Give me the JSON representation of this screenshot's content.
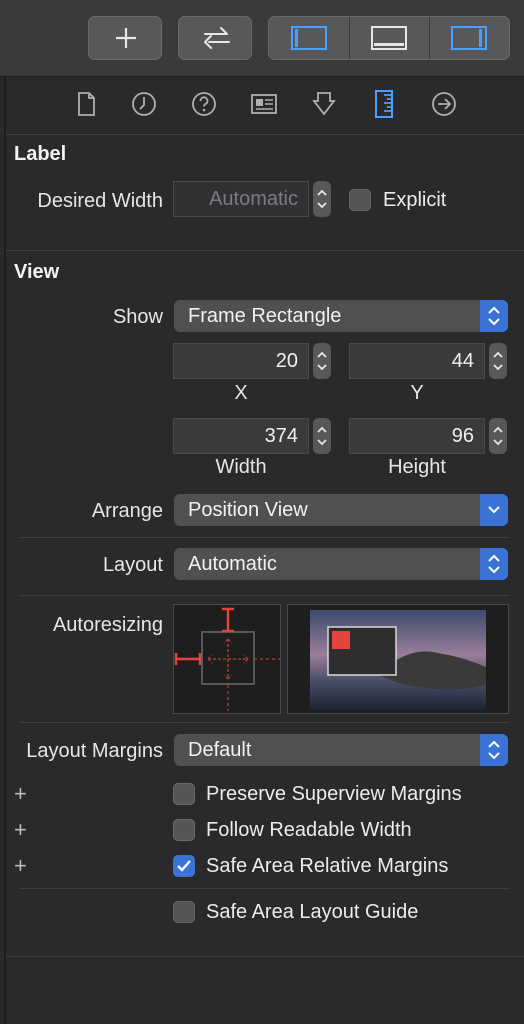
{
  "toolbar": {
    "add_icon": "plus-icon",
    "swap_icon": "arrows-left-right-icon",
    "panels": [
      "left-panel-icon",
      "bottom-panel-icon",
      "right-panel-icon"
    ],
    "active_color": "#4aa0ff"
  },
  "inspector_tabs": [
    "file-icon",
    "history-icon",
    "help-icon",
    "identity-icon",
    "attributes-icon",
    "size-ruler-icon",
    "connections-icon"
  ],
  "label_section": {
    "title": "Label",
    "desired_width_label": "Desired Width",
    "desired_width_value": "Automatic",
    "explicit_label": "Explicit",
    "explicit_checked": false
  },
  "view_section": {
    "title": "View",
    "show_label": "Show",
    "show_value": "Frame Rectangle",
    "x_value": "20",
    "y_value": "44",
    "x_label": "X",
    "y_label": "Y",
    "width_value": "374",
    "height_value": "96",
    "width_label": "Width",
    "height_label": "Height",
    "arrange_label": "Arrange",
    "arrange_value": "Position View",
    "layout_label": "Layout",
    "layout_value": "Automatic",
    "autoresizing_label": "Autoresizing",
    "layout_margins_label": "Layout Margins",
    "layout_margins_value": "Default",
    "checkboxes": [
      {
        "label": "Preserve Superview Margins",
        "checked": false,
        "has_plus": true
      },
      {
        "label": "Follow Readable Width",
        "checked": false,
        "has_plus": true
      },
      {
        "label": "Safe Area Relative Margins",
        "checked": true,
        "has_plus": true
      },
      {
        "label": "Safe Area Layout Guide",
        "checked": false,
        "has_plus": false
      }
    ],
    "plus_symbol": "+"
  }
}
